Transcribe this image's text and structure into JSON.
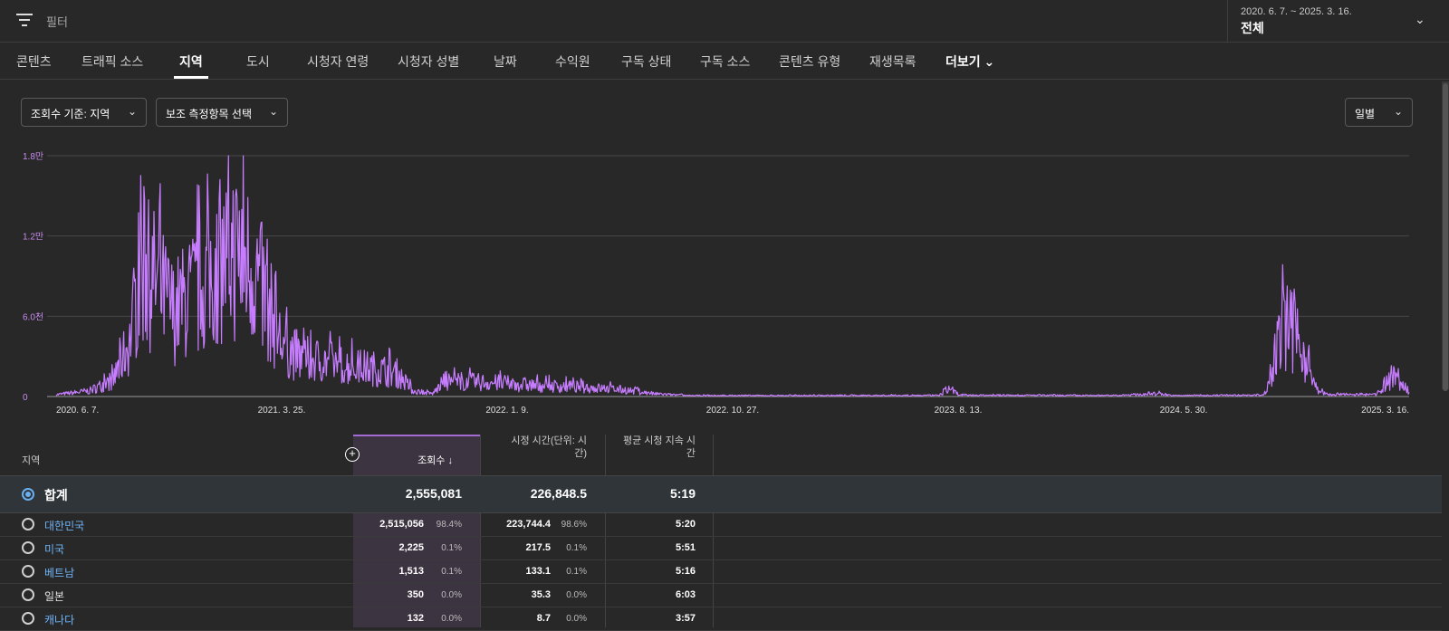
{
  "filter": {
    "placeholder": "필터"
  },
  "date_range": {
    "dates": "2020. 6. 7. ~ 2025. 3. 16.",
    "label": "전체"
  },
  "tabs": [
    {
      "label": "콘텐츠",
      "active": false
    },
    {
      "label": "트래픽 소스",
      "active": false
    },
    {
      "label": "지역",
      "active": true
    },
    {
      "label": "도시",
      "active": false
    },
    {
      "label": "시청자 연령",
      "active": false
    },
    {
      "label": "시청자 성별",
      "active": false
    },
    {
      "label": "날짜",
      "active": false
    },
    {
      "label": "수익원",
      "active": false
    },
    {
      "label": "구독 상태",
      "active": false
    },
    {
      "label": "구독 소스",
      "active": false
    },
    {
      "label": "콘텐츠 유형",
      "active": false
    },
    {
      "label": "재생목록",
      "active": false
    }
  ],
  "more_tab": {
    "label": "더보기"
  },
  "controls": {
    "metric": "조회수 기준: 지역",
    "secondary": "보조 측정항목 선택",
    "interval": "일별"
  },
  "colors": {
    "line": "#c77dff",
    "accent": "#6ab0f0",
    "selected_col": "#3d3442"
  },
  "chart_data": {
    "type": "line",
    "ytick_labels": [
      "0",
      "6.0천",
      "1.2만",
      "1.8만"
    ],
    "ytick_values": [
      0,
      6000,
      12000,
      18000
    ],
    "ylim": [
      0,
      18000
    ],
    "xtick_labels": [
      "2020. 6. 7.",
      "2021. 3. 25.",
      "2022. 1. 9.",
      "2022. 10. 27.",
      "2023. 8. 13.",
      "2024. 5. 30.",
      "2025. 3. 16."
    ],
    "x_start": "2020-06-07",
    "x_end": "2025-03-16",
    "grid": true,
    "envelope": [
      [
        "2020-06-07",
        200
      ],
      [
        "2020-07-20",
        600
      ],
      [
        "2020-08-20",
        1800
      ],
      [
        "2020-09-10",
        6000
      ],
      [
        "2020-09-25",
        14000
      ],
      [
        "2020-10-15",
        12000
      ],
      [
        "2020-11-05",
        9000
      ],
      [
        "2020-12-01",
        11000
      ],
      [
        "2020-12-25",
        13000
      ],
      [
        "2021-01-20",
        15500
      ],
      [
        "2021-02-15",
        14000
      ],
      [
        "2021-03-10",
        9000
      ],
      [
        "2021-03-25",
        5500
      ],
      [
        "2021-04-20",
        4000
      ],
      [
        "2021-05-20",
        3800
      ],
      [
        "2021-06-20",
        3200
      ],
      [
        "2021-07-20",
        3000
      ],
      [
        "2021-08-20",
        2500
      ],
      [
        "2021-09-10",
        600
      ],
      [
        "2021-10-05",
        300
      ],
      [
        "2021-10-20",
        1600
      ],
      [
        "2021-12-15",
        1500
      ],
      [
        "2022-02-15",
        1200
      ],
      [
        "2022-04-15",
        1000
      ],
      [
        "2022-06-10",
        700
      ],
      [
        "2022-07-15",
        300
      ],
      [
        "2022-09-01",
        100
      ],
      [
        "2023-07-20",
        120
      ],
      [
        "2023-08-01",
        900
      ],
      [
        "2023-08-15",
        150
      ],
      [
        "2024-03-01",
        100
      ],
      [
        "2024-05-01",
        300
      ],
      [
        "2024-05-15",
        100
      ],
      [
        "2024-09-10",
        150
      ],
      [
        "2024-09-25",
        4500
      ],
      [
        "2024-10-05",
        7500
      ],
      [
        "2024-10-15",
        7000
      ],
      [
        "2024-11-05",
        3800
      ],
      [
        "2024-11-15",
        800
      ],
      [
        "2024-12-01",
        200
      ],
      [
        "2025-02-01",
        200
      ],
      [
        "2025-02-25",
        2200
      ],
      [
        "2025-03-16",
        500
      ]
    ]
  },
  "table": {
    "headers": {
      "region": "지역",
      "views": "조회수",
      "watch_time": "시정 시간(단위: 시간)",
      "avg_duration": "평균 시청 지속 시간"
    },
    "total": {
      "name": "합계",
      "views": "2,555,081",
      "watch_time": "226,848.5",
      "avg": "5:19"
    },
    "rows": [
      {
        "name": "대한민국",
        "link": true,
        "views": "2,515,056",
        "views_pct": "98.4%",
        "watch": "223,744.4",
        "watch_pct": "98.6%",
        "avg": "5:20"
      },
      {
        "name": "미국",
        "link": true,
        "views": "2,225",
        "views_pct": "0.1%",
        "watch": "217.5",
        "watch_pct": "0.1%",
        "avg": "5:51"
      },
      {
        "name": "베트남",
        "link": true,
        "views": "1,513",
        "views_pct": "0.1%",
        "watch": "133.1",
        "watch_pct": "0.1%",
        "avg": "5:16"
      },
      {
        "name": "일본",
        "link": false,
        "views": "350",
        "views_pct": "0.0%",
        "watch": "35.3",
        "watch_pct": "0.0%",
        "avg": "6:03"
      },
      {
        "name": "캐나다",
        "link": true,
        "views": "132",
        "views_pct": "0.0%",
        "watch": "8.7",
        "watch_pct": "0.0%",
        "avg": "3:57"
      }
    ]
  }
}
